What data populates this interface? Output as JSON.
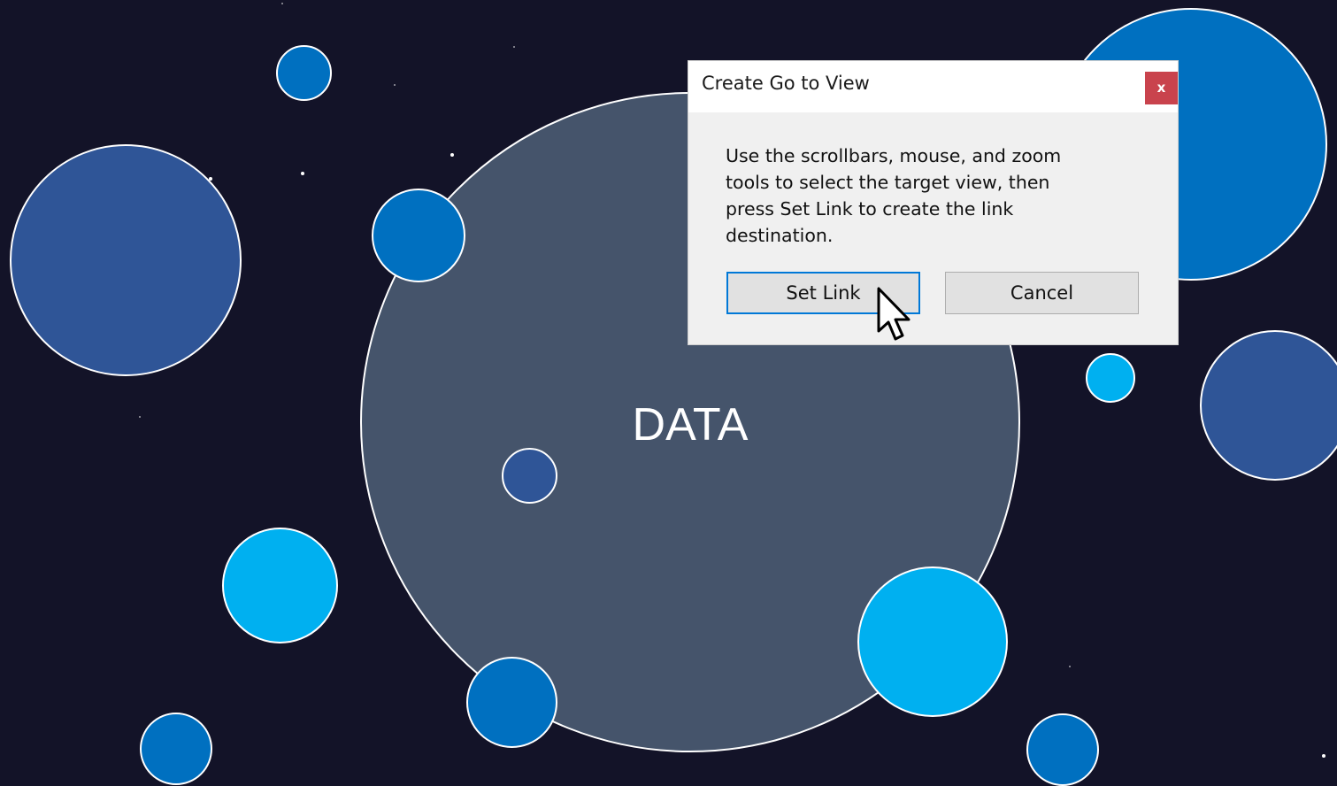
{
  "slide": {
    "center_label": "DATA",
    "colors": {
      "background": "#131328",
      "center_circle": "#45546b",
      "blue": "#0070c0",
      "steel_blue": "#2f5597",
      "cyan": "#00b0f0",
      "outline": "#ffffff"
    }
  },
  "dialog": {
    "title": "Create Go to View",
    "close_label": "x",
    "message": "Use the scrollbars, mouse, and zoom\ntools to select the target view, then\npress Set Link to create the link\ndestination.",
    "set_link_label": "Set Link",
    "cancel_label": "Cancel",
    "focused_button": "Set Link"
  },
  "cursor": {
    "icon": "arrow-pointer-icon"
  }
}
